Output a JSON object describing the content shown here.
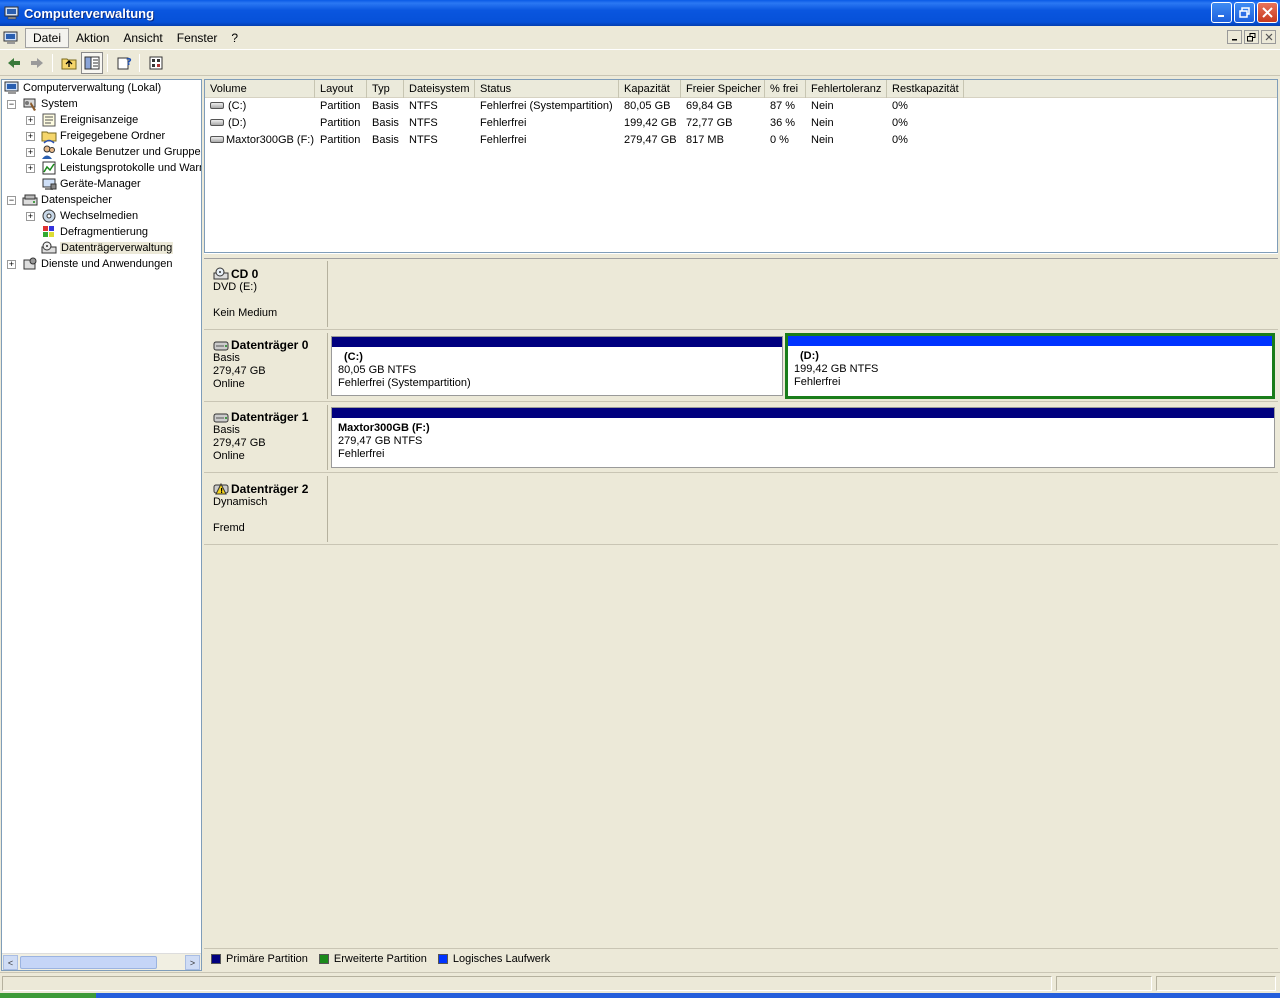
{
  "window": {
    "title": "Computerverwaltung",
    "minimize_icon": "minimize-icon",
    "maximize_icon": "restore-icon",
    "close_icon": "close-icon"
  },
  "menu": {
    "items": [
      "Datei",
      "Aktion",
      "Ansicht",
      "Fenster",
      "?"
    ]
  },
  "toolbar": {
    "icons": [
      "back-arrow-icon",
      "forward-arrow-icon",
      "up-folder-icon",
      "show-hide-tree-icon",
      "help-icon",
      "properties-icon"
    ]
  },
  "tree": {
    "root": "Computerverwaltung (Lokal)",
    "system": "System",
    "ereignisanzeige": "Ereignisanzeige",
    "freigegebene_ordner": "Freigegebene Ordner",
    "lokale_benutzer": "Lokale Benutzer und Gruppen",
    "leistungsprotokolle": "Leistungsprotokolle und Warn",
    "geraete_manager": "Geräte-Manager",
    "datenspeicher": "Datenspeicher",
    "wechselmedien": "Wechselmedien",
    "defragmentierung": "Defragmentierung",
    "datentraegerverwaltung": "Datenträgerverwaltung",
    "dienste": "Dienste und Anwendungen",
    "expand_plus": "+",
    "expand_minus": "−",
    "scroll_left": "<",
    "scroll_right": ">"
  },
  "volume_list": {
    "headers": [
      "Volume",
      "Layout",
      "Typ",
      "Dateisystem",
      "Status",
      "Kapazität",
      "Freier Speicher",
      "% frei",
      "Fehlertoleranz",
      "Restkapazität"
    ],
    "rows": [
      {
        "volume": "(C:)",
        "layout": "Partition",
        "typ": "Basis",
        "dateisystem": "NTFS",
        "status": "Fehlerfrei (Systempartition)",
        "kapazitaet": "80,05 GB",
        "frei": "69,84 GB",
        "prozent": "87 %",
        "fehlertoleranz": "Nein",
        "rest": "0%"
      },
      {
        "volume": "(D:)",
        "layout": "Partition",
        "typ": "Basis",
        "dateisystem": "NTFS",
        "status": "Fehlerfrei",
        "kapazitaet": "199,42 GB",
        "frei": "72,77 GB",
        "prozent": "36 %",
        "fehlertoleranz": "Nein",
        "rest": "0%"
      },
      {
        "volume": "Maxtor300GB (F:)",
        "layout": "Partition",
        "typ": "Basis",
        "dateisystem": "NTFS",
        "status": "Fehlerfrei",
        "kapazitaet": "279,47 GB",
        "frei": "817 MB",
        "prozent": "0 %",
        "fehlertoleranz": "Nein",
        "rest": "0%"
      }
    ]
  },
  "disks": {
    "cd0": {
      "name": "CD 0",
      "line1": "DVD (E:)",
      "line2": "",
      "line3": "Kein Medium"
    },
    "disk0": {
      "name": "Datenträger 0",
      "line1": "Basis",
      "line2": "279,47 GB",
      "line3": "Online",
      "partC": {
        "name": "(C:)",
        "size": "80,05 GB NTFS",
        "status": "Fehlerfrei (Systempartition)"
      },
      "partD": {
        "name": "(D:)",
        "size": "199,42 GB NTFS",
        "status": "Fehlerfrei"
      }
    },
    "disk1": {
      "name": "Datenträger 1",
      "line1": "Basis",
      "line2": "279,47 GB",
      "line3": "Online",
      "partF": {
        "name": "Maxtor300GB  (F:)",
        "size": "279,47 GB NTFS",
        "status": "Fehlerfrei"
      }
    },
    "disk2": {
      "name": "Datenträger 2",
      "line1": "Dynamisch",
      "line2": "",
      "line3": "Fremd"
    }
  },
  "legend": {
    "primary": "Primäre Partition",
    "extended": "Erweiterte Partition",
    "logical": "Logisches Laufwerk",
    "colors": {
      "primary": "#00007f",
      "extended": "#1a8a1a",
      "logical": "#0033ff"
    }
  }
}
